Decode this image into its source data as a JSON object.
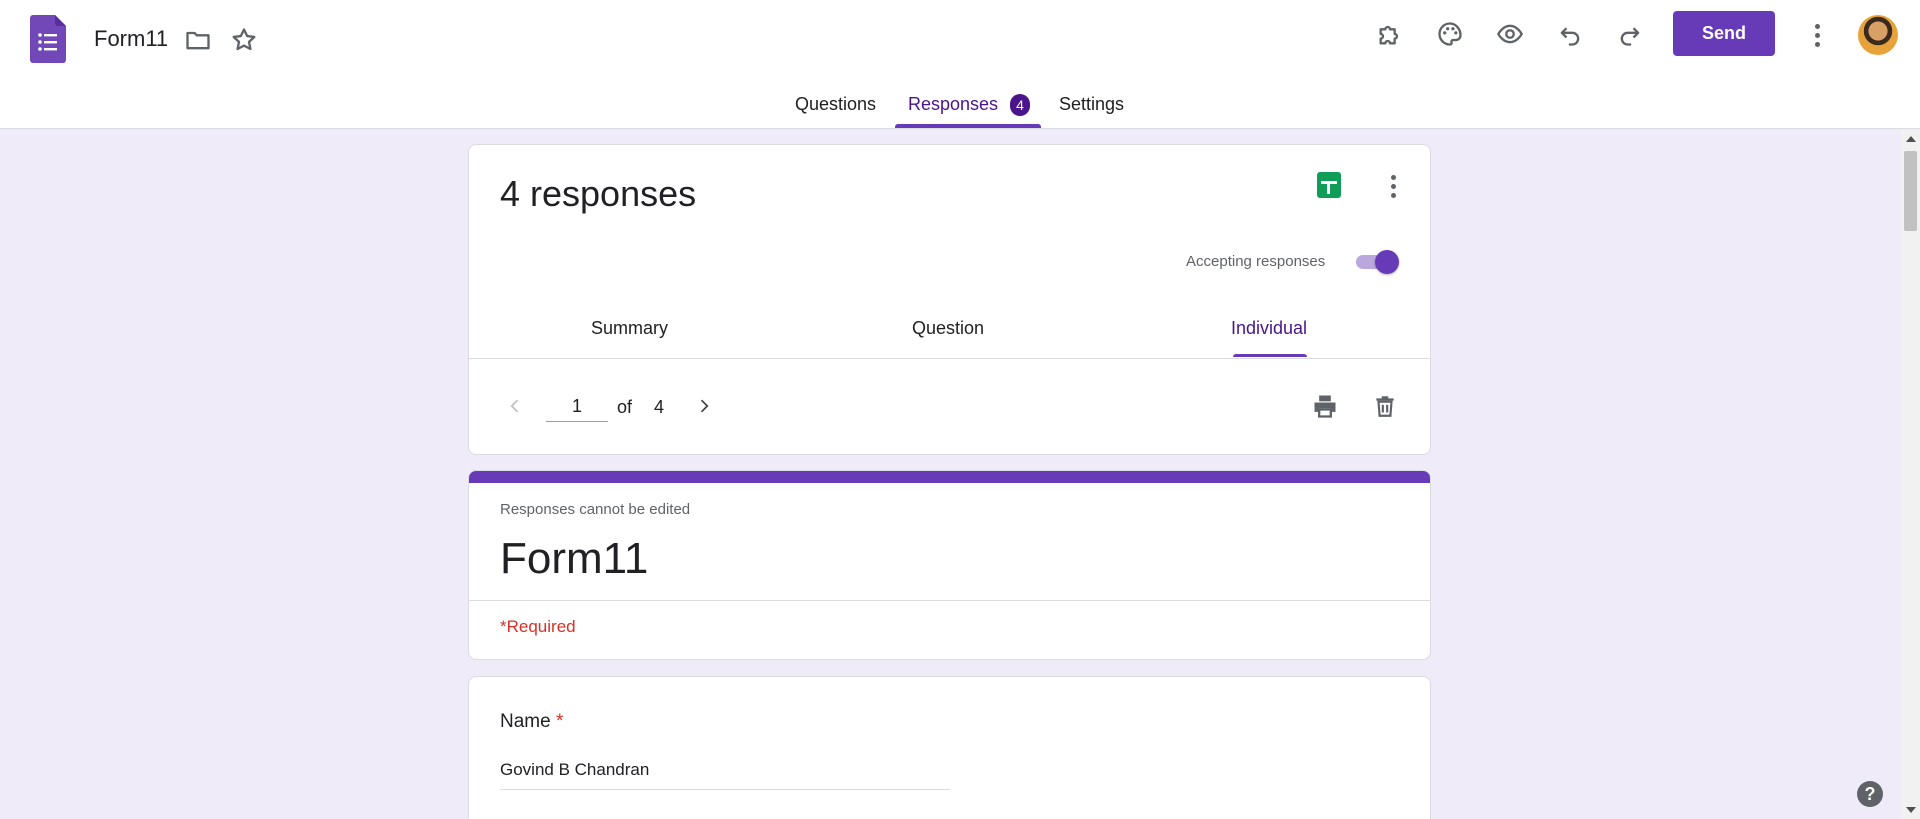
{
  "header": {
    "title": "Form11",
    "send_label": "Send",
    "icons": [
      "forms-logo-icon",
      "folder-icon",
      "star-icon",
      "addon-icon",
      "palette-icon",
      "preview-eye-icon",
      "undo-icon",
      "redo-icon",
      "more-vert-icon",
      "account-avatar"
    ]
  },
  "tabs": {
    "questions": "Questions",
    "responses": "Responses",
    "responses_badge": "4",
    "settings": "Settings",
    "active": "Responses"
  },
  "summary_card": {
    "count_label": "4 responses",
    "accepting_label": "Accepting responses",
    "accepting_on": true,
    "subtabs": [
      "Summary",
      "Question",
      "Individual"
    ],
    "active_subtab": "Individual",
    "pager": {
      "current": "1",
      "of": "of",
      "total": "4"
    }
  },
  "response_header": {
    "note": "Responses cannot be edited",
    "form_title": "Form11",
    "required_note": "*Required"
  },
  "question": {
    "label": "Name",
    "required_mark": "*",
    "answer": "Govind B Chandran"
  },
  "help_label": "?",
  "colors": {
    "accent": "#673ab7",
    "accent_dark": "#4a148c",
    "background": "#f0ebf8",
    "required": "#d93025",
    "sheets": "#0f9d58"
  }
}
